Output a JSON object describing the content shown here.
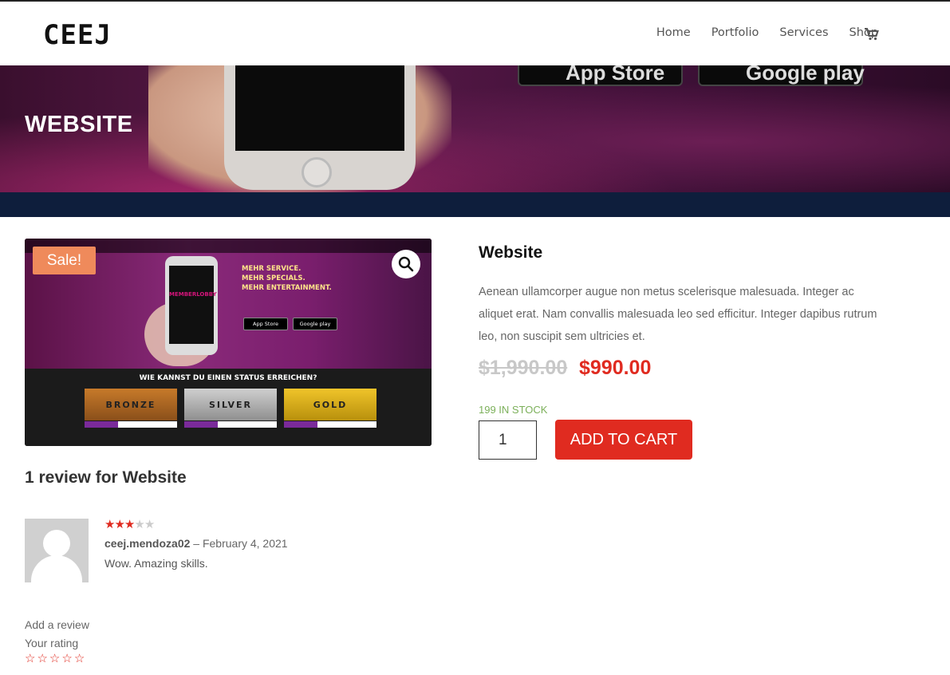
{
  "header": {
    "logo": "CEEJ",
    "nav": [
      "Home",
      "Portfolio",
      "Services",
      "Shop"
    ]
  },
  "hero": {
    "title": "WEBSITE",
    "badges": [
      "App Store",
      "Google play"
    ]
  },
  "gallery": {
    "sale_label": "Sale!",
    "screen_label": "MEMBERLOBBY",
    "promo_lines": [
      "MEHR SERVICE.",
      "MEHR SPECIALS.",
      "MEHR ENTERTAINMENT."
    ],
    "store_buttons": [
      "App Store",
      "Google play"
    ],
    "status_heading": "WIE KANNST DU EINEN STATUS ERREICHEN?",
    "tiers": [
      "BRONZE",
      "SILVER",
      "GOLD"
    ]
  },
  "product": {
    "title": "Website",
    "description": "Aenean ullamcorper augue non metus scelerisque malesuada. Integer ac aliquet erat. Nam convallis malesuada leo sed efficitur. Integer dapibus rutrum leo, non suscipit sem ultricies et.",
    "price_old": "$1,990.00",
    "price_new": "$990.00",
    "stock": "199 IN STOCK",
    "quantity": "1",
    "add_to_cart": "ADD TO CART"
  },
  "reviews": {
    "heading": "1 review for Website",
    "items": [
      {
        "author": "ceej.mendoza02",
        "date": "– February 4, 2021",
        "text": "Wow. Amazing skills.",
        "rating": 3,
        "max_rating": 5
      }
    ],
    "add_review": "Add a review",
    "your_rating": "Your rating"
  },
  "colors": {
    "accent": "#e02b20",
    "sale_badge": "#ef8a5b",
    "stock": "#7cb05a",
    "hero_band": "#0e1e3c"
  }
}
